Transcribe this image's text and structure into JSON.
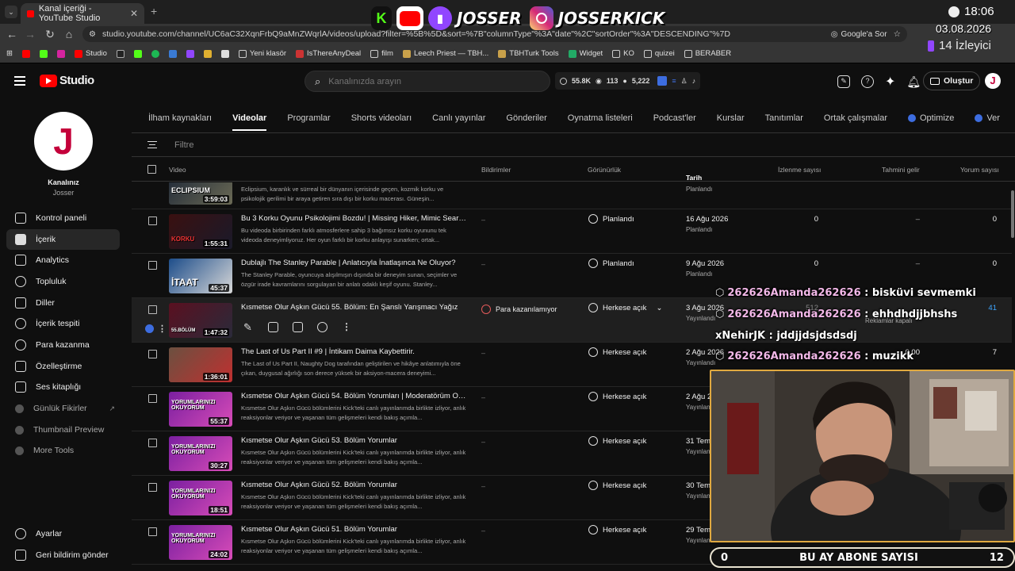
{
  "browser": {
    "tab_title": "Kanal içeriği - YouTube Studio",
    "url": "studio.youtube.com/channel/UC6aC32XqnFrbQ9aMnZWqrlA/videos/upload?filter=%5B%5D&sort=%7B\"columnType\"%3A\"date\"%2C\"sortOrder\"%3A\"DESCENDING\"%7D",
    "translate_label": "Google'a Sor",
    "bookmarks": [
      "Studio",
      "Yeni klasör",
      "IsThereAnyDeal",
      "film",
      "Leech Priest — TBH...",
      "TBHTurk Tools",
      "Widget",
      "KO",
      "quizei",
      "BERABER"
    ]
  },
  "overlay": {
    "brand1": "JOSSER",
    "brand2": "JOSSERKICK",
    "time": "18:06",
    "date": "03.08.2026",
    "viewers": "14 İzleyici",
    "chat": [
      {
        "user": "262626Amanda262626",
        "msg": ": bisküvi sevmemki"
      },
      {
        "user": "262626Amanda262626",
        "msg": ": ehhdhdjjbhshs"
      },
      {
        "user": "xNehirJK",
        "msg": ": jddjjdsjdsdsdj"
      },
      {
        "user": "262626Amanda262626",
        "msg": ": muzikk"
      }
    ],
    "sub_left": "0",
    "sub_label": "BU AY ABONE SAYISI",
    "sub_right": "12"
  },
  "header": {
    "logo_text": "Studio",
    "search_placeholder": "Kanalınızda arayın",
    "stat_subs": "55.8K",
    "stat_views": "113",
    "stat_other": "5,222",
    "create_label": "Oluştur",
    "avatar_letter": "J"
  },
  "sidebar": {
    "avatar_letter": "J",
    "channel_label": "Kanalınız",
    "channel_name": "Josser",
    "items": [
      {
        "label": "Kontrol paneli"
      },
      {
        "label": "İçerik"
      },
      {
        "label": "Analytics"
      },
      {
        "label": "Topluluk"
      },
      {
        "label": "Diller"
      },
      {
        "label": "İçerik tespiti"
      },
      {
        "label": "Para kazanma"
      },
      {
        "label": "Özelleştirme"
      },
      {
        "label": "Ses kitaplığı"
      },
      {
        "label": "Günlük Fikirler"
      },
      {
        "label": "Thumbnail Preview"
      },
      {
        "label": "More Tools"
      }
    ],
    "settings": "Ayarlar",
    "feedback": "Geri bildirim gönder"
  },
  "tabs": [
    "İlham kaynakları",
    "Videolar",
    "Programlar",
    "Shorts videoları",
    "Canlı yayınlar",
    "Gönderiler",
    "Oynatma listeleri",
    "Podcast'ler",
    "Kurslar",
    "Tanıtımlar",
    "Ortak çalışmalar",
    "Optimize",
    "Ver"
  ],
  "filter_placeholder": "Filtre",
  "columns": {
    "video": "Video",
    "monet": "Bildirimler",
    "visibility": "Görünürlük",
    "date": "Tarih",
    "views": "İzlenme sayısı",
    "revenue": "Tahmini gelir",
    "comments": "Yorum sayısı"
  },
  "rows": [
    {
      "title": "",
      "desc": "Eclipsium, karanlık ve sürreal bir dünyanın içerisinde geçen, kozmik korku ve psikolojik gerilimi bir araya getiren sıra dışı bir korku macerası. Güneşin...",
      "duration": "3:59:03",
      "thumb_text": "ECLIPSIUM",
      "monet": "",
      "visibility": "",
      "date": "",
      "date_sub": "Planlandı",
      "views": "",
      "revenue": "",
      "comments": "",
      "color1": "#1c2636",
      "color2": "#6b6a55"
    },
    {
      "title": "Bu 3 Korku Oyunu Psikolojimi Bozdu! | Missing Hiker, Mimic Search...",
      "desc": "Bu videoda birbirinden farklı atmosferlere sahip 3 bağımsız korku oyununu tek videoda deneyimliyoruz. Her oyun farklı bir korku anlayışı sunarken; ortak...",
      "duration": "1:55:31",
      "thumb_text": "KORKU",
      "monet": "–",
      "visibility": "Planlandı",
      "date": "16 Ağu 2026",
      "date_sub": "Planlandı",
      "views": "0",
      "revenue": "–",
      "comments": "0",
      "color1": "#3a1010",
      "color2": "#1a1a2a"
    },
    {
      "title": "Dublajlı The Stanley Parable | Anlatıcıyla İnatlaşınca Ne Oluyor?",
      "desc": "The Stanley Parable, oyuncuya alışılmışın dışında bir deneyim sunan, seçimler ve özgür irade kavramlarını sorgulayan bir anlatı odaklı keşif oyunu. Stanley...",
      "duration": "45:37",
      "thumb_text": "İTAAT",
      "monet": "–",
      "visibility": "Planlandı",
      "date": "9 Ağu 2026",
      "date_sub": "Planlandı",
      "views": "0",
      "revenue": "–",
      "comments": "0",
      "color1": "#1d4d8a",
      "color2": "#d8d8d8"
    },
    {
      "title": "Kısmetse Olur Aşkın Gücü 55. Bölüm: En Şanslı Yarışmacı Yağız",
      "desc": "",
      "duration": "1:47:32",
      "thumb_text": "55.BÖLÜM",
      "monet": "Para kazanılamıyor",
      "visibility": "Herkese açık",
      "date": "3 Ağu 2026",
      "date_sub": "Yayınlandı",
      "views": "512",
      "revenue": "Reklamlar kapalı",
      "comments": "41",
      "color1": "#5a1020",
      "color2": "#2a2a3a"
    },
    {
      "title": "The Last of Us Part II #9 | İntikam Daima Kaybettirir.",
      "desc": "The Last of Us Part II, Naughty Dog tarafından geliştirilen ve hikâye anlatımıyla öne çıkan, duygusal ağırlığı son derece yüksek bir aksiyon-macera deneyimi...",
      "duration": "1:36:01",
      "thumb_text": "",
      "monet": "–",
      "visibility": "Herkese açık",
      "date": "2 Ağu 2026",
      "date_sub": "Yayınlandı",
      "views": "",
      "revenue": "0,00",
      "comments": "7",
      "color1": "#6b5040",
      "color2": "#c03030"
    },
    {
      "title": "Kısmetse Olur Aşkın Gücü 54. Bölüm Yorumları | Moderatörüm Oku...",
      "desc": "Kısmetse Olur Aşkın Gücü bölümlerini Kick'teki canlı yayınlarımda birlikte izliyor, anlık reaksiyonlar veriyor ve yaşanan tüm gelişmeleri kendi bakış açımla...",
      "duration": "55:37",
      "thumb_text": "YORUMLARINIZI OKUYORUM",
      "monet": "–",
      "visibility": "Herkese açık",
      "date": "2 Ağu 2026",
      "date_sub": "Yayınlandı",
      "views": "",
      "revenue": "",
      "comments": "",
      "color1": "#7a1fa0",
      "color2": "#d84cb8"
    },
    {
      "title": "Kısmetse Olur Aşkın Gücü 53. Bölüm Yorumlar",
      "desc": "Kısmetse Olur Aşkın Gücü bölümlerini Kick'teki canlı yayınlarımda birlikte izliyor, anlık reaksiyonlar veriyor ve yaşanan tüm gelişmeleri kendi bakış açımla...",
      "duration": "30:27",
      "thumb_text": "YORUMLARINIZI OKUYORUM",
      "monet": "–",
      "visibility": "Herkese açık",
      "date": "31 Tem",
      "date_sub": "Yayınlandı",
      "views": "",
      "revenue": "",
      "comments": "",
      "color1": "#7a1fa0",
      "color2": "#d84cb8"
    },
    {
      "title": "Kısmetse Olur Aşkın Gücü 52. Bölüm Yorumlar",
      "desc": "Kısmetse Olur Aşkın Gücü bölümlerini Kick'teki canlı yayınlarımda birlikte izliyor, anlık reaksiyonlar veriyor ve yaşanan tüm gelişmeleri kendi bakış açımla...",
      "duration": "18:51",
      "thumb_text": "YORUMLARINIZI OKUYORUM",
      "monet": "–",
      "visibility": "Herkese açık",
      "date": "30 Tem",
      "date_sub": "Yayınlandı",
      "views": "",
      "revenue": "",
      "comments": "",
      "color1": "#7a1fa0",
      "color2": "#d84cb8"
    },
    {
      "title": "Kısmetse Olur Aşkın Gücü 51. Bölüm Yorumlar",
      "desc": "Kısmetse Olur Aşkın Gücü bölümlerini Kick'teki canlı yayınlarımda birlikte izliyor, anlık reaksiyonlar veriyor ve yaşanan tüm gelişmeleri kendi bakış açımla...",
      "duration": "24:02",
      "thumb_text": "YORUMLARINIZI OKUYORUM",
      "monet": "–",
      "visibility": "Herkese açık",
      "date": "29 Tem",
      "date_sub": "Yayınlandı",
      "views": "",
      "revenue": "",
      "comments": "",
      "color1": "#7a1fa0",
      "color2": "#d84cb8"
    }
  ]
}
